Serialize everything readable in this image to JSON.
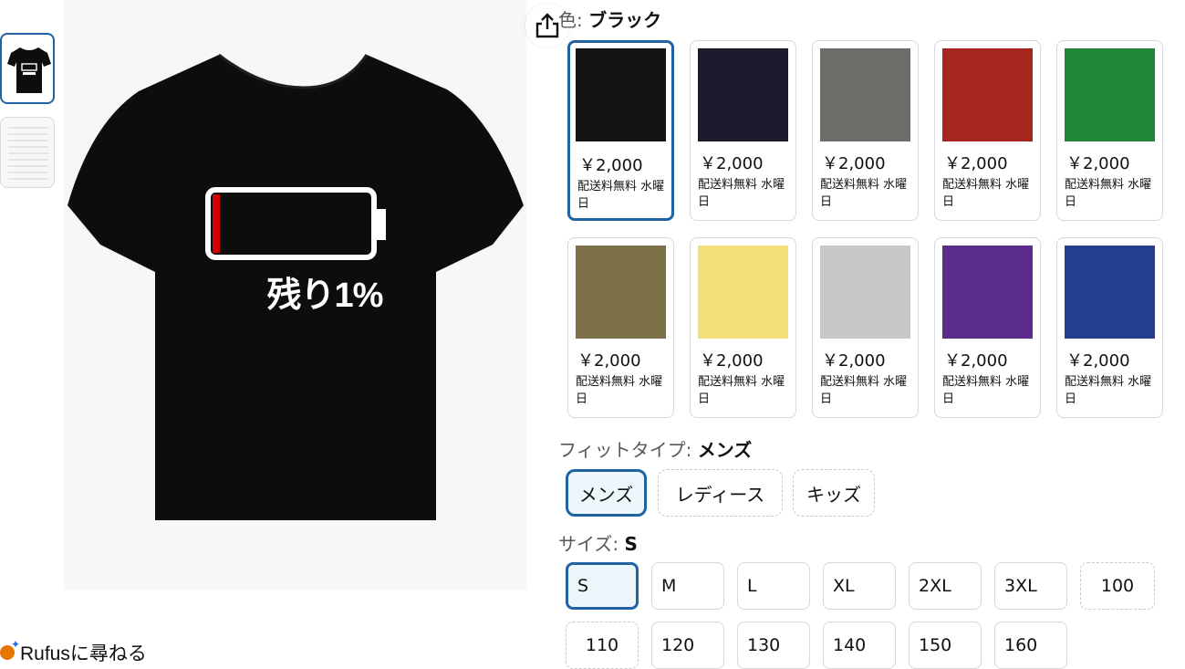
{
  "colors": {
    "selected_border": "#2162a1",
    "shirt": "#0d0d0d",
    "battery_red": "#d40000"
  },
  "product": {
    "shirt_text": "残り1%",
    "share_icon": "share-icon"
  },
  "rufus": {
    "label": "Rufusに尋ねる",
    "icon": "rufus-sparkle-icon"
  },
  "color_selector": {
    "label_prefix": "色:",
    "selected": "ブラック",
    "options": [
      {
        "hex": "#141414",
        "price": "￥2,000",
        "shipping": "配送料無料 水曜日"
      },
      {
        "hex": "#1b1a2c",
        "price": "￥2,000",
        "shipping": "配送料無料 水曜日"
      },
      {
        "hex": "#6c6c69",
        "price": "￥2,000",
        "shipping": "配送料無料 水曜日"
      },
      {
        "hex": "#a5251f",
        "price": "￥2,000",
        "shipping": "配送料無料 水曜日"
      },
      {
        "hex": "#1f8737",
        "price": "￥2,000",
        "shipping": "配送料無料 水曜日"
      },
      {
        "hex": "#7c7048",
        "price": "￥2,000",
        "shipping": "配送料無料 水曜日"
      },
      {
        "hex": "#f2e078",
        "price": "￥2,000",
        "shipping": "配送料無料 水曜日"
      },
      {
        "hex": "#c7c7c7",
        "price": "￥2,000",
        "shipping": "配送料無料 水曜日"
      },
      {
        "hex": "#5a2d8c",
        "price": "￥2,000",
        "shipping": "配送料無料 水曜日"
      },
      {
        "hex": "#253e8e",
        "price": "￥2,000",
        "shipping": "配送料無料 水曜日"
      }
    ]
  },
  "fit_selector": {
    "label_prefix": "フィットタイプ:",
    "selected": "メンズ",
    "options": [
      "メンズ",
      "レディース",
      "キッズ"
    ]
  },
  "size_selector": {
    "label_prefix": "サイズ:",
    "selected": "S",
    "options": [
      "S",
      "M",
      "L",
      "XL",
      "2XL",
      "3XL",
      "100",
      "110",
      "120",
      "130",
      "140",
      "150",
      "160"
    ]
  }
}
